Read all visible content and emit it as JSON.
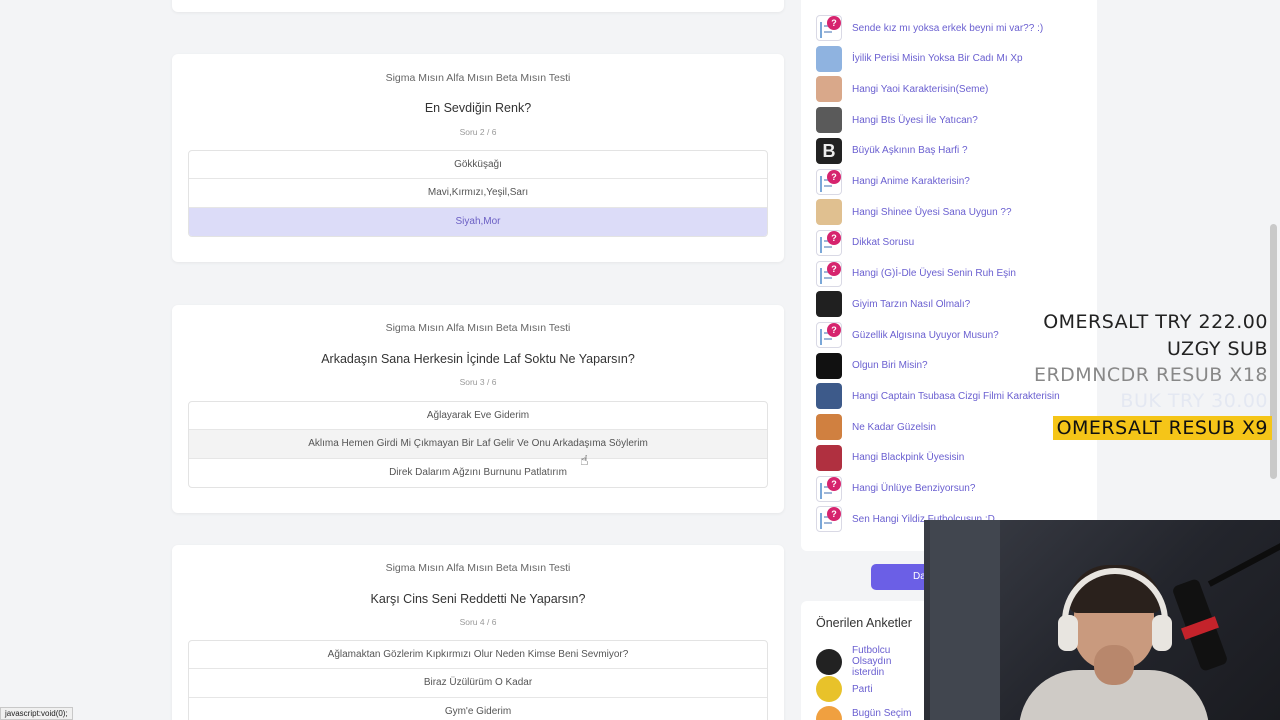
{
  "questions": [
    {
      "quiz_title": "Sigma Mısın Alfa Mısın Beta Mısın Testi",
      "question": "En Sevdiğin Renk?",
      "progress": "Soru 2 / 6",
      "options": [
        "Gökküşağı",
        "Mavi,Kırmızı,Yeşil,Sarı",
        "Siyah,Mor"
      ],
      "selected_index": 2
    },
    {
      "quiz_title": "Sigma Mısın Alfa Mısın Beta Mısın Testi",
      "question": "Arkadaşın Sana Herkesin İçinde Laf Soktu Ne Yaparsın?",
      "progress": "Soru 3 / 6",
      "options": [
        "Ağlayarak Eve Giderim",
        "Aklıma Hemen Girdi Mi Çıkmayan Bir Laf Gelir Ve Onu Arkadaşıma Söylerim",
        "Direk Dalarım Ağzını Burnunu Patlatırım"
      ],
      "hover_index": 1
    },
    {
      "quiz_title": "Sigma Mısın Alfa Mısın Beta Mısın Testi",
      "question": "Karşı Cins Seni Reddetti Ne Yaparsın?",
      "progress": "Soru 4 / 6",
      "options": [
        "Ağlamaktan Gözlerim Kıpkırmızı Olur Neden Kimse Beni Sevmiyor?",
        "Biraz Üzülürüm O Kadar",
        "Gym'e Giderim"
      ]
    }
  ],
  "sidebar": {
    "items": [
      {
        "label": "Sende kız mı yoksa erkek beyni mi var?? :)",
        "icon": "question-thumb"
      },
      {
        "label": "İyilik Perisi Misin Yoksa Bir Cadı Mı Xp",
        "icon": "image-thumb",
        "color": "#8fb3e0"
      },
      {
        "label": "Hangi Yaoi Karakterisin(Seme)",
        "icon": "image-thumb",
        "color": "#d9a88a"
      },
      {
        "label": "Hangi Bts Üyesi İle Yatıcan?",
        "icon": "image-thumb",
        "color": "#5a5a5a"
      },
      {
        "label": "Büyük Aşkının Baş Harfi ?",
        "icon": "letter-thumb",
        "color": "#222222"
      },
      {
        "label": "Hangi Anime Karakterisin?",
        "icon": "question-thumb"
      },
      {
        "label": "Hangi Shinee Üyesi Sana Uygun ??",
        "icon": "image-thumb",
        "color": "#e0c090"
      },
      {
        "label": "Dikkat Sorusu",
        "icon": "question-thumb"
      },
      {
        "label": "Hangi (G)İ-Dle Üyesi Senin Ruh Eşin",
        "icon": "question-thumb"
      },
      {
        "label": "Giyim Tarzın Nasıl Olmalı?",
        "icon": "image-thumb",
        "color": "#202020"
      },
      {
        "label": "Güzellik Algısına Uyuyor Musun?",
        "icon": "question-thumb"
      },
      {
        "label": "Olgun Biri Misin?",
        "icon": "image-thumb",
        "color": "#111111"
      },
      {
        "label": "Hangi Captain Tsubasa Cizgi Filmi Karakterisin",
        "icon": "image-thumb",
        "color": "#3d5a8a"
      },
      {
        "label": "Ne Kadar Güzelsin",
        "icon": "image-thumb",
        "color": "#d08040"
      },
      {
        "label": "Hangi Blackpink Üyesisin",
        "icon": "image-thumb",
        "color": "#b03040"
      },
      {
        "label": "Hangi Ünlüye Benziyorsun?",
        "icon": "question-thumb"
      },
      {
        "label": "Sen Hangi Yildiz Futbolcusun :D",
        "icon": "question-thumb"
      }
    ],
    "more_button": "Da"
  },
  "suggested": {
    "title": "Önerilen Anketler",
    "items": [
      {
        "label": "Futbolcu Olsaydın isterdin",
        "color": "#222222"
      },
      {
        "label": "Parti",
        "color": "#e8c22a"
      },
      {
        "label": "Bugün Seçim O",
        "color": "#f0a040"
      }
    ]
  },
  "overlay": {
    "line1": "OMERSALT  TRY 222.00",
    "line2": "UZGY  SUB",
    "line3": "ERDMNCDR  RESUB X18",
    "line4": "BUK  TRY 30.00",
    "line5": "OMERSALT  RESUB X9"
  },
  "status_url": "javascript:void(0);",
  "colors": {
    "accent": "#6a5fd0",
    "selected_bg": "#dcdcf8",
    "badge": "#d6246e",
    "highlight": "#f5c518"
  }
}
